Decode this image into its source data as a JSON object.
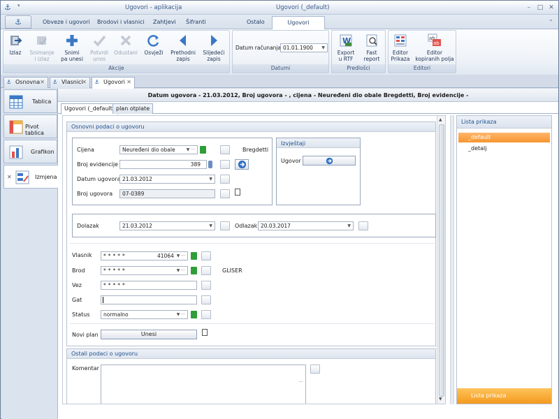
{
  "window": {
    "app_title": "Ugovori - aplikacija",
    "context_title": "Ugovori (_default)"
  },
  "ribbon_tabs": [
    {
      "label": "Obveze i ugovori"
    },
    {
      "label": "Brodovi i vlasnici"
    },
    {
      "label": "Zahtjevi"
    },
    {
      "label": "Šifranti"
    },
    {
      "label": "Ostalo"
    },
    {
      "label": "Ugovori"
    }
  ],
  "ribbon": {
    "akcije": {
      "label": "Akcije",
      "buttons": [
        {
          "label": "Izlaz",
          "icon": "exit-icon",
          "enabled": true
        },
        {
          "label": "Snimanje\ni izlaz",
          "icon": "save-exit-icon",
          "enabled": false
        },
        {
          "label": "Snimi\npa unesi",
          "icon": "plus-icon",
          "enabled": true
        },
        {
          "label": "Potvrdi\nunos",
          "icon": "check-icon",
          "enabled": false
        },
        {
          "label": "Odustani",
          "icon": "cancel-icon",
          "enabled": false
        },
        {
          "label": "Osvježi",
          "icon": "refresh-icon",
          "enabled": true
        },
        {
          "label": "Prethodni\nzapis",
          "icon": "previous-icon",
          "enabled": true
        },
        {
          "label": "Slijedeći\nzapis",
          "icon": "next-icon",
          "enabled": true
        }
      ]
    },
    "datumi": {
      "label": "Datumi",
      "field_label": "Datum računanja",
      "field_value": "01.01.1900"
    },
    "predlosci": {
      "label": "Predlošci",
      "buttons": [
        {
          "label": "Export\nu RTF",
          "icon": "rtf-icon"
        },
        {
          "label": "Fast\nreport",
          "icon": "report-icon"
        }
      ]
    },
    "editori": {
      "label": "Editori",
      "buttons": [
        {
          "label": "Editor\nPrikaza",
          "icon": "editor-view-icon"
        },
        {
          "label": "Editor\nkopiranih polja",
          "icon": "editor-fields-icon"
        }
      ]
    }
  },
  "doc_tabs": [
    {
      "label": "Osnovna"
    },
    {
      "label": "Vlasnici"
    },
    {
      "label": "Ugovori"
    }
  ],
  "sidebar": [
    {
      "label": "Tablica",
      "icon": "table-icon"
    },
    {
      "label": "Pivot tablica",
      "icon": "pivot-icon"
    },
    {
      "label": "Grafikon",
      "icon": "chart-icon"
    },
    {
      "label": "Izmjena",
      "icon": "edit-icon"
    }
  ],
  "header_line": "Datum ugovora - 21.03.2012, Broj ugovora -                , cijena - Neuređeni dio obale Bregdetti, Broj evidencije -",
  "sub_tabs": [
    {
      "label": "Ugovori (_default)"
    },
    {
      "label": "plan otplate"
    }
  ],
  "osnovni": {
    "title": "Osnovni podaci o ugovoru",
    "cijena_label": "Cijena",
    "cijena_value": "Neuređeni dio obale",
    "cijena_extra": "Bregdetti",
    "broj_evidencije_label": "Broj evidencije",
    "broj_evidencije_value": "389",
    "datum_ugovora_label": "Datum ugovora",
    "datum_ugovora_value": "21.03.2012",
    "broj_ugovora_label": "Broj ugovora",
    "broj_ugovora_value": "07-0389",
    "izvjestaji_title": "Izvještaji",
    "ugovor_label": "Ugovor",
    "dolazak_label": "Dolazak",
    "dolazak_value": "21.03.2012",
    "odlazak_label": "Odlazak",
    "odlazak_value": "20.03.2017",
    "vlasnik_label": "Vlasnik",
    "vlasnik_value": "*****",
    "vlasnik_id": "41064",
    "brod_label": "Brod",
    "brod_value": "*****",
    "brod_extra": "GLISER",
    "vez_label": "Vez",
    "vez_value": "*****",
    "gat_label": "Gat",
    "gat_value": "",
    "status_label": "Status",
    "status_value": "normalno",
    "novi_plan_label": "Novi plan",
    "unesi_label": "Unesi"
  },
  "ostali": {
    "title": "Ostali podaci o ugovoru",
    "komentar_label": "Komentar",
    "komentar_value": ""
  },
  "lista_prikaza": {
    "title": "Lista prikaza",
    "items": [
      "_default",
      "_detalj"
    ],
    "footer": "Lista prikaza"
  },
  "colors": {
    "accent_blue": "#2a5fa0",
    "selection_orange": "#f6962f"
  }
}
